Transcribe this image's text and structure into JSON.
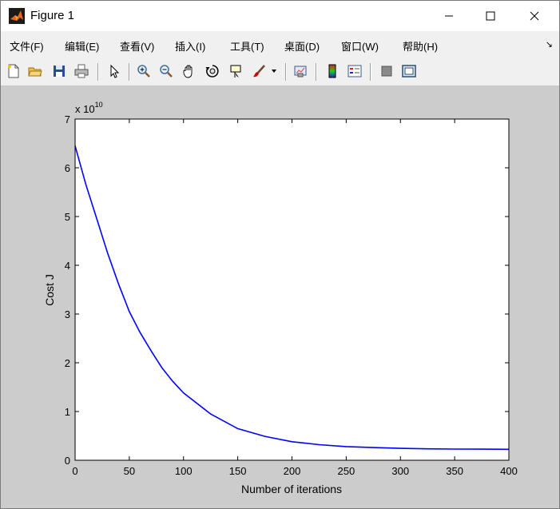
{
  "window": {
    "title": "Figure 1",
    "controls": {
      "minimize": "minimize",
      "maximize": "maximize",
      "close": "close"
    }
  },
  "menu": {
    "items": [
      {
        "label": "文件(F)"
      },
      {
        "label": "编辑(E)"
      },
      {
        "label": "查看(V)"
      },
      {
        "label": "插入(I)"
      },
      {
        "label": "工具(T)"
      },
      {
        "label": "桌面(D)"
      },
      {
        "label": "窗口(W)"
      },
      {
        "label": "帮助(H)"
      }
    ],
    "overflow_icon": "dock-arrow-icon"
  },
  "toolbar": {
    "buttons": [
      {
        "icon": "new-figure-icon"
      },
      {
        "icon": "open-file-icon"
      },
      {
        "icon": "save-icon"
      },
      {
        "icon": "print-icon"
      },
      {
        "icon": "edit-plot-arrow-icon"
      },
      {
        "icon": "zoom-in-icon"
      },
      {
        "icon": "zoom-out-icon"
      },
      {
        "icon": "pan-hand-icon"
      },
      {
        "icon": "rotate-3d-icon"
      },
      {
        "icon": "data-cursor-icon"
      },
      {
        "icon": "brush-icon"
      },
      {
        "icon": "link-plot-icon"
      },
      {
        "icon": "colorbar-icon"
      },
      {
        "icon": "legend-icon"
      },
      {
        "icon": "hide-plot-tools-icon"
      },
      {
        "icon": "show-plot-tools-icon"
      }
    ]
  },
  "chart_data": {
    "type": "line",
    "title": "",
    "xlabel": "Number of iterations",
    "ylabel": "Cost J",
    "y_exponent_label": "x 10",
    "y_exponent": "10",
    "xlim": [
      0,
      400
    ],
    "ylim": [
      0,
      7
    ],
    "xticks": [
      0,
      50,
      100,
      150,
      200,
      250,
      300,
      350,
      400
    ],
    "yticks": [
      0,
      1,
      2,
      3,
      4,
      5,
      6,
      7
    ],
    "grid": false,
    "legend": "none",
    "series": [
      {
        "color": "#0000ff",
        "x": [
          0,
          10,
          20,
          30,
          40,
          50,
          60,
          70,
          80,
          90,
          100,
          125,
          150,
          175,
          200,
          225,
          250,
          275,
          300,
          325,
          350,
          375,
          400
        ],
        "y": [
          6.45,
          5.65,
          4.95,
          4.25,
          3.62,
          3.05,
          2.62,
          2.25,
          1.9,
          1.62,
          1.38,
          0.95,
          0.65,
          0.49,
          0.38,
          0.32,
          0.28,
          0.26,
          0.245,
          0.235,
          0.23,
          0.228,
          0.225
        ]
      }
    ]
  }
}
